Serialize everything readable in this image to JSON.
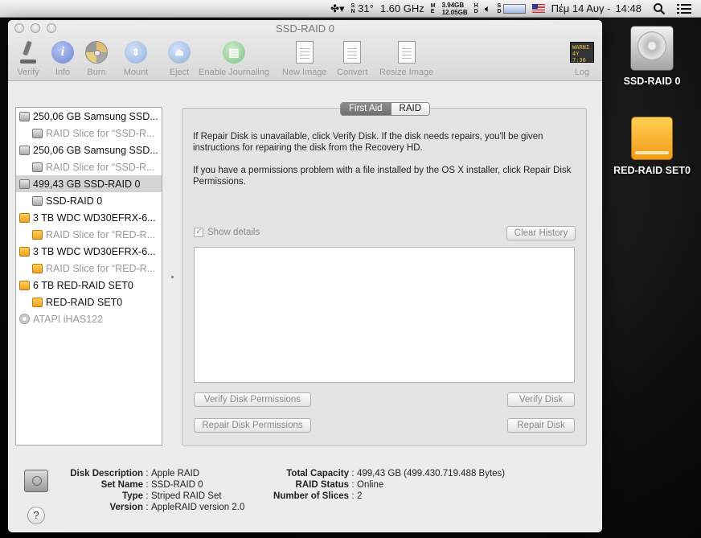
{
  "menubar": {
    "temp": "31°",
    "cpu": "1.60 GHz",
    "mem_top": "3.94GB",
    "mem_bottom": "12.05GB",
    "date": "Πέμ 14 Αυγ -",
    "time": "14:48"
  },
  "window": {
    "title": "SSD-RAID 0"
  },
  "toolbar": {
    "verify": "Verify",
    "info": "Info",
    "burn": "Burn",
    "mount": "Mount",
    "eject": "Eject",
    "enable_journaling": "Enable Journaling",
    "new_image": "New Image",
    "convert": "Convert",
    "resize_image": "Resize Image",
    "log": "Log",
    "log_icon_text": "WARNI 4Y 7:36"
  },
  "sidebar": {
    "items": [
      {
        "label": "250,06 GB Samsung SSD...",
        "icon": "gray",
        "level": 0,
        "dim": false,
        "selected": false
      },
      {
        "label": "RAID Slice for “SSD-R...",
        "icon": "gray",
        "level": 1,
        "dim": true,
        "selected": false
      },
      {
        "label": "250,06 GB Samsung SSD...",
        "icon": "gray",
        "level": 0,
        "dim": false,
        "selected": false
      },
      {
        "label": "RAID Slice for “SSD-R...",
        "icon": "gray",
        "level": 1,
        "dim": true,
        "selected": false
      },
      {
        "label": "499,43 GB SSD-RAID 0",
        "icon": "gray",
        "level": 0,
        "dim": false,
        "selected": true
      },
      {
        "label": "SSD-RAID 0",
        "icon": "gray",
        "level": 1,
        "dim": false,
        "selected": false
      },
      {
        "label": "3 TB WDC WD30EFRX-6...",
        "icon": "orange",
        "level": 0,
        "dim": false,
        "selected": false
      },
      {
        "label": "RAID Slice for “RED-R...",
        "icon": "orange",
        "level": 1,
        "dim": true,
        "selected": false
      },
      {
        "label": "3 TB WDC WD30EFRX-6...",
        "icon": "orange",
        "level": 0,
        "dim": false,
        "selected": false
      },
      {
        "label": "RAID Slice for “RED-R...",
        "icon": "orange",
        "level": 1,
        "dim": true,
        "selected": false
      },
      {
        "label": "6 TB RED-RAID SET0",
        "icon": "orange",
        "level": 0,
        "dim": false,
        "selected": false
      },
      {
        "label": "RED-RAID SET0",
        "icon": "orange",
        "level": 1,
        "dim": false,
        "selected": false
      },
      {
        "label": "ATAPI iHAS122",
        "icon": "cd",
        "level": 0,
        "dim": true,
        "selected": false
      }
    ]
  },
  "tabs": {
    "first_aid": "First Aid",
    "raid": "RAID"
  },
  "first_aid": {
    "para1": "If Repair Disk is unavailable, click Verify Disk. If the disk needs repairs, you'll be given instructions for repairing the disk from the Recovery HD.",
    "para2": "If you have a permissions problem with a file installed by the OS X installer, click Repair Disk Permissions.",
    "show_details": "Show details",
    "clear_history": "Clear History",
    "verify_permissions": "Verify Disk Permissions",
    "verify_disk": "Verify Disk",
    "repair_permissions": "Repair Disk Permissions",
    "repair_disk": "Repair Disk"
  },
  "info": {
    "disk_description_key": "Disk Description",
    "disk_description": "Apple RAID",
    "set_name_key": "Set Name",
    "set_name": "SSD-RAID 0",
    "type_key": "Type",
    "type": "Striped RAID Set",
    "version_key": "Version",
    "version": "AppleRAID version 2.0",
    "total_capacity_key": "Total Capacity",
    "total_capacity": "499,43 GB (499.430.719.488 Bytes)",
    "raid_status_key": "RAID Status",
    "raid_status": "Online",
    "slices_key": "Number of Slices",
    "slices": "2",
    "help": "?"
  },
  "desktop": {
    "icon1": "SSD-RAID 0",
    "icon2": "RED-RAID SET0"
  }
}
